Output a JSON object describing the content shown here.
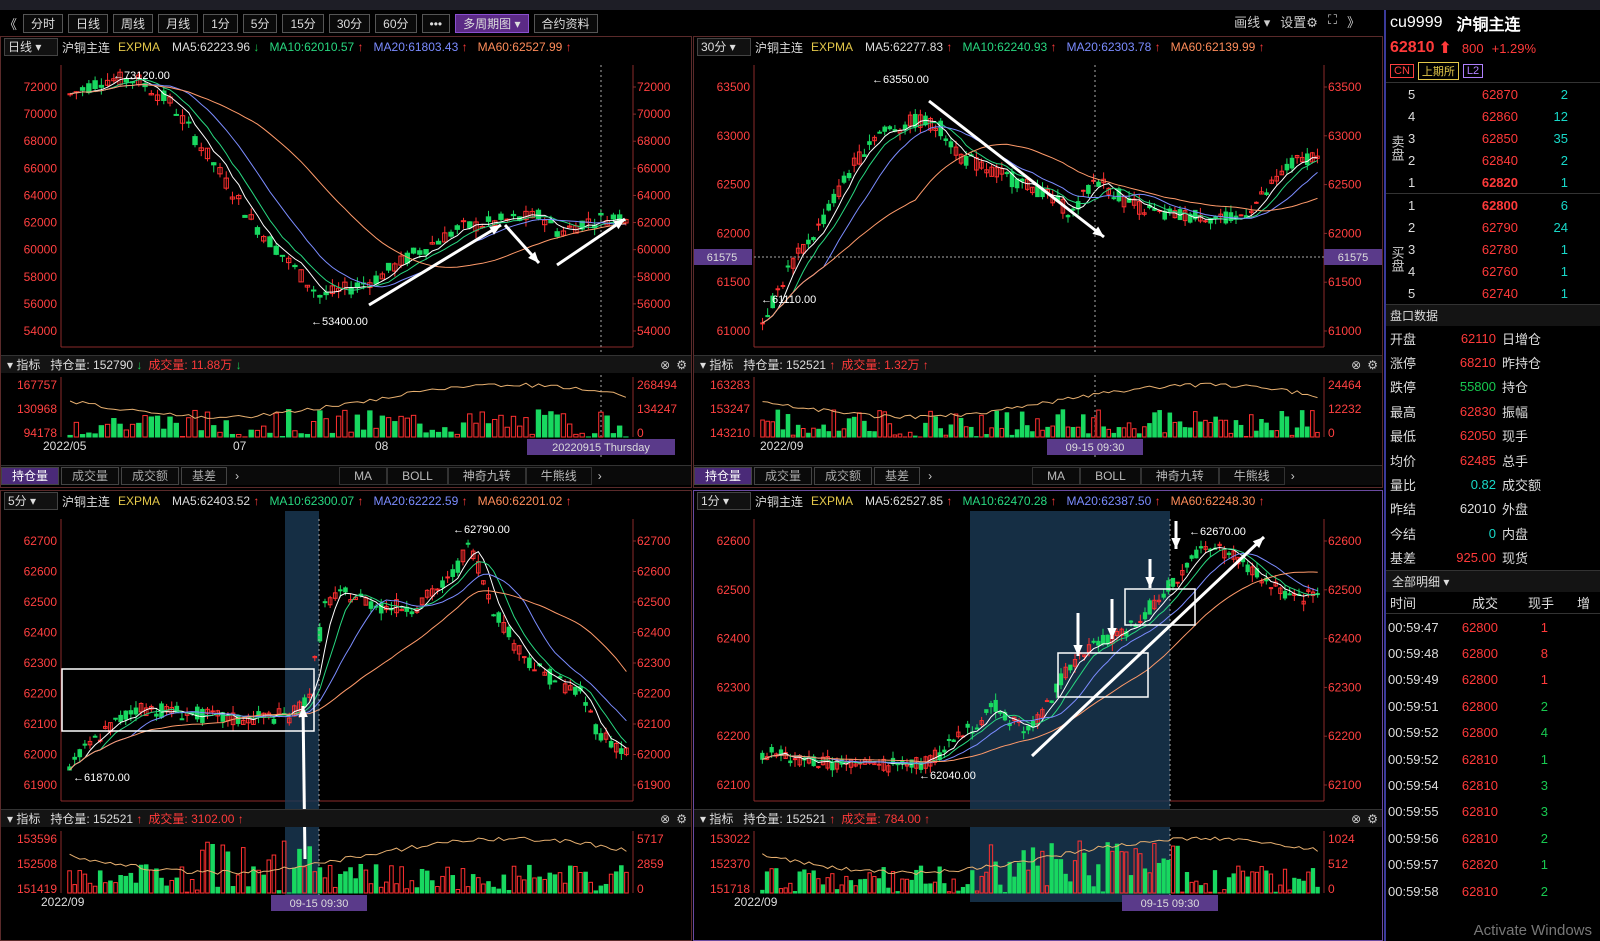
{
  "toolbar": {
    "buttons": [
      "分时",
      "日线",
      "周线",
      "月线",
      "1分",
      "5分",
      "15分",
      "30分",
      "60分",
      "•••",
      "多周期图 ▾",
      "合约资料"
    ],
    "active": 10,
    "right": [
      "画线 ▾",
      "设置⚙",
      "⛶"
    ],
    "nav_left": "《",
    "nav_right": "》"
  },
  "panels": [
    {
      "id": "p1",
      "period": "日线",
      "symbol": "沪铜主连",
      "indicator": "EXPMA",
      "ma5": "MA5:62223.96",
      "ma5_dir": "dn",
      "ma10": "MA10:62010.57",
      "ma10_dir": "up",
      "ma20": "MA20:61803.43",
      "ma20_dir": "up",
      "ma60": "MA60:62527.99",
      "ma60_dir": "up",
      "y_left": [
        "72000",
        "70000",
        "68000",
        "66000",
        "64000",
        "62000",
        "60000",
        "58000",
        "56000",
        "54000"
      ],
      "y_right": [
        "72000",
        "70000",
        "68000",
        "66000",
        "64000",
        "62000",
        "60000",
        "58000",
        "56000",
        "54000"
      ],
      "hi_label": "73120.00",
      "lo_label": "53400.00",
      "sub_label": "指标",
      "oi": "持仓量: 152790",
      "oi_dir": "dn",
      "vol": "成交量: 11.88万",
      "vol_dir": "dn",
      "sub_left": [
        "167757",
        "130968",
        "94178"
      ],
      "sub_right": [
        "268494",
        "134247",
        "0"
      ],
      "x_ticks": [
        "2022/05",
        "07",
        "08"
      ],
      "cursor_label": "20220915 Thursday",
      "tabs": [
        "持仓量",
        "成交量",
        "成交额",
        "基差"
      ],
      "tabs2": [
        "MA",
        "BOLL",
        "神奇九转",
        "牛熊线"
      ]
    },
    {
      "id": "p2",
      "period": "30分",
      "symbol": "沪铜主连",
      "indicator": "EXPMA",
      "ma5": "MA5:62277.83",
      "ma5_dir": "up",
      "ma10": "MA10:62240.93",
      "ma10_dir": "up",
      "ma20": "MA20:62303.78",
      "ma20_dir": "up",
      "ma60": "MA60:62139.99",
      "ma60_dir": "up",
      "y_left": [
        "63500",
        "63000",
        "62500",
        "62000",
        "61500",
        "61000"
      ],
      "y_right": [
        "63500",
        "63000",
        "62500",
        "62000",
        "61500",
        "61000"
      ],
      "hi_label": "63550.00",
      "lo_label": "61110.00",
      "cross_label": "61575",
      "sub_label": "指标",
      "oi": "持仓量: 152521",
      "oi_dir": "up",
      "vol": "成交量: 1.32万",
      "vol_dir": "up",
      "sub_left": [
        "163283",
        "153247",
        "143210"
      ],
      "sub_right": [
        "24464",
        "12232",
        "0"
      ],
      "x_ticks": [
        "2022/09"
      ],
      "cursor_label": "09-15 09:30",
      "tabs": [
        "持仓量",
        "成交量",
        "成交额",
        "基差"
      ],
      "tabs2": [
        "MA",
        "BOLL",
        "神奇九转",
        "牛熊线"
      ]
    },
    {
      "id": "p3",
      "period": "5分",
      "symbol": "沪铜主连",
      "indicator": "EXPMA",
      "ma5": "MA5:62403.52",
      "ma5_dir": "up",
      "ma10": "MA10:62300.07",
      "ma10_dir": "up",
      "ma20": "MA20:62222.59",
      "ma20_dir": "up",
      "ma60": "MA60:62201.02",
      "ma60_dir": "up",
      "y_left": [
        "62700",
        "62600",
        "62500",
        "62400",
        "62300",
        "62200",
        "62100",
        "62000",
        "61900"
      ],
      "y_right": [
        "62700",
        "62600",
        "62500",
        "62400",
        "62300",
        "62200",
        "62100",
        "62000",
        "61900"
      ],
      "hi_label": "62790.00",
      "lo_label": "61870.00",
      "sub_label": "指标",
      "oi": "持仓量: 152521",
      "oi_dir": "up",
      "vol": "成交量: 3102.00",
      "vol_dir": "up",
      "sub_left": [
        "153596",
        "152508",
        "151419"
      ],
      "sub_right": [
        "5717",
        "2859",
        "0"
      ],
      "x_ticks": [
        "2022/09"
      ],
      "cursor_label": "09-15 09:30"
    },
    {
      "id": "p4",
      "period": "1分",
      "symbol": "沪铜主连",
      "indicator": "EXPMA",
      "ma5": "MA5:62527.85",
      "ma5_dir": "up",
      "ma10": "MA10:62470.28",
      "ma10_dir": "up",
      "ma20": "MA20:62387.50",
      "ma20_dir": "up",
      "ma60": "MA60:62248.30",
      "ma60_dir": "up",
      "y_left": [
        "62600",
        "62500",
        "62400",
        "62300",
        "62200",
        "62100"
      ],
      "y_right": [
        "62600",
        "62500",
        "62400",
        "62300",
        "62200",
        "62100"
      ],
      "hi_label": "62670.00",
      "lo_label": "62040.00",
      "sub_label": "指标",
      "oi": "持仓量: 152521",
      "oi_dir": "up",
      "vol": "成交量: 784.00",
      "vol_dir": "up",
      "sub_left": [
        "153022",
        "152370",
        "151718"
      ],
      "sub_right": [
        "1024",
        "512",
        "0"
      ],
      "x_ticks": [
        "2022/09"
      ],
      "cursor_label": "09-15 09:30"
    }
  ],
  "side": {
    "code": "cu9999",
    "name": "沪铜主连",
    "price": "62810",
    "arrow": "⬆",
    "change": "800",
    "pct": "+1.29%",
    "tags": [
      "CN",
      "上期所",
      "L2"
    ],
    "asks": [
      [
        "5",
        "62870",
        "2"
      ],
      [
        "4",
        "62860",
        "12"
      ],
      [
        "3",
        "62850",
        "35"
      ],
      [
        "2",
        "62840",
        "2"
      ],
      [
        "1",
        "62820",
        "1"
      ]
    ],
    "bids": [
      [
        "1",
        "62800",
        "6"
      ],
      [
        "2",
        "62790",
        "24"
      ],
      [
        "3",
        "62780",
        "1"
      ],
      [
        "4",
        "62760",
        "1"
      ],
      [
        "5",
        "62740",
        "1"
      ]
    ],
    "ask_label": "卖盘",
    "bid_label": "买盘",
    "pankou_title": "盘口数据",
    "pankou": [
      [
        "开盘",
        "62110",
        "日增仓"
      ],
      [
        "涨停",
        "68210",
        "昨持仓"
      ],
      [
        "跌停",
        "55800",
        "持仓"
      ],
      [
        "最高",
        "62830",
        "振幅"
      ],
      [
        "最低",
        "62050",
        "现手"
      ],
      [
        "均价",
        "62485",
        "总手"
      ],
      [
        "量比",
        "0.82",
        "成交额"
      ],
      [
        "昨结",
        "62010",
        "外盘"
      ],
      [
        "今结",
        "0",
        "内盘"
      ],
      [
        "基差",
        "925.00",
        "现货"
      ]
    ],
    "detail_title": "全部明细 ▾",
    "detail_cols": [
      "时间",
      "成交",
      "现手",
      "增"
    ],
    "trades": [
      [
        "00:59:47",
        "62800",
        "1"
      ],
      [
        "00:59:48",
        "62800",
        "8"
      ],
      [
        "00:59:49",
        "62800",
        "1"
      ],
      [
        "00:59:51",
        "62800",
        "2"
      ],
      [
        "00:59:52",
        "62800",
        "4"
      ],
      [
        "00:59:52",
        "62810",
        "1"
      ],
      [
        "00:59:54",
        "62810",
        "3"
      ],
      [
        "00:59:55",
        "62810",
        "3"
      ],
      [
        "00:59:56",
        "62810",
        "2"
      ],
      [
        "00:59:57",
        "62820",
        "1"
      ],
      [
        "00:59:58",
        "62810",
        "2"
      ]
    ]
  },
  "watermark": "Activate Windows"
}
